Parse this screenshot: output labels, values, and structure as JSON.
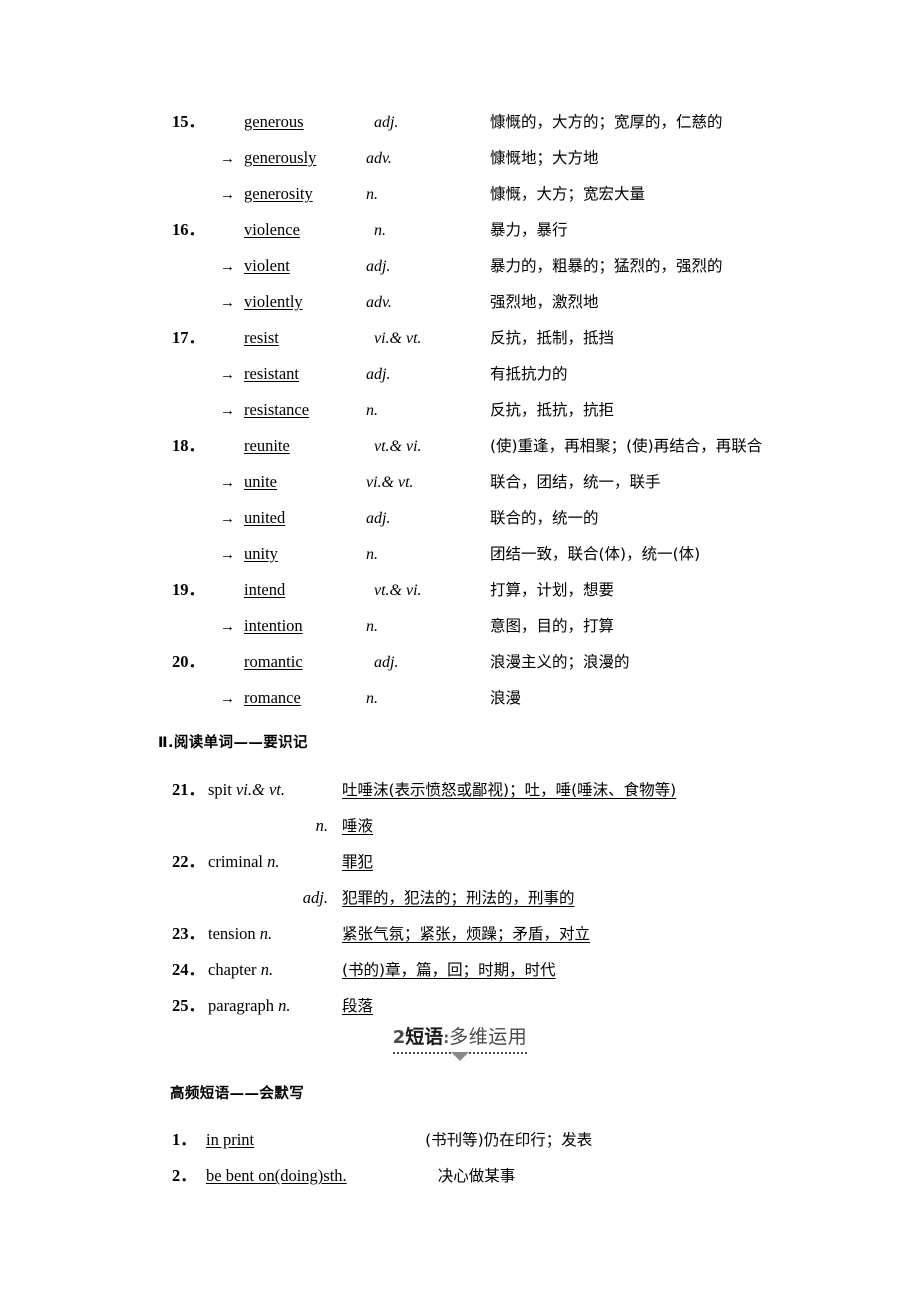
{
  "section_one": {
    "entries": [
      {
        "num": "15．",
        "arrow": "",
        "word": "generous",
        "pos": "adj.",
        "def": "慷慨的，大方的；宽厚的，仁慈的"
      },
      {
        "num": "",
        "arrow": "→",
        "word": "generously",
        "pos": "adv.",
        "def": "慷慨地；大方地"
      },
      {
        "num": "",
        "arrow": "→",
        "word": "generosity",
        "pos": "n.",
        "def": "慷慨，大方；宽宏大量"
      },
      {
        "num": "16．",
        "arrow": "",
        "word": "violence",
        "pos": "n.",
        "def": "暴力，暴行"
      },
      {
        "num": "",
        "arrow": "→",
        "word": "violent",
        "pos": "adj.",
        "def": "暴力的，粗暴的；猛烈的，强烈的"
      },
      {
        "num": "",
        "arrow": "→",
        "word": "violently",
        "pos": "adv.",
        "def": "强烈地，激烈地"
      },
      {
        "num": "17．",
        "arrow": "",
        "word": "resist",
        "pos": "vi.& vt.",
        "def": "反抗，抵制，抵挡"
      },
      {
        "num": "",
        "arrow": "→",
        "word": "resistant",
        "pos": "adj.",
        "def": "有抵抗力的"
      },
      {
        "num": "",
        "arrow": "→",
        "word": "resistance",
        "pos": "n.",
        "def": "反抗，抵抗，抗拒"
      },
      {
        "num": "18．",
        "arrow": "",
        "word": "reunite",
        "pos": "vt.& vi.",
        "def": "(使)重逢，再相聚；(使)再结合，再联合"
      },
      {
        "num": "",
        "arrow": "→",
        "word": "unite",
        "pos": "vi.& vt.",
        "def": "联合，团结，统一，联手"
      },
      {
        "num": "",
        "arrow": "→",
        "word": "united",
        "pos": "adj.",
        "def": "联合的，统一的"
      },
      {
        "num": "",
        "arrow": "→",
        "word": "unity",
        "pos": "n.",
        "def": "团结一致，联合(体)，统一(体)"
      },
      {
        "num": "19．",
        "arrow": "",
        "word": "intend",
        "pos": "vt.& vi.",
        "def": "打算，计划，想要"
      },
      {
        "num": "",
        "arrow": "→",
        "word": "intention",
        "pos": "n.",
        "def": "意图，目的，打算"
      },
      {
        "num": "20．",
        "arrow": "",
        "word": "romantic",
        "pos": "adj.",
        "def": "浪漫主义的；浪漫的"
      },
      {
        "num": "",
        "arrow": "→",
        "word": "romance",
        "pos": "n.",
        "def": "浪漫"
      }
    ]
  },
  "heading_reading": "Ⅱ.阅读单词——要识记",
  "section_two": {
    "entries": [
      {
        "num": "21．",
        "word": "spit ",
        "pos": "vi.& vt.",
        "pos_only": false,
        "def": "吐唾沫(表示愤怒或鄙视)；吐，唾(唾沫、食物等)"
      },
      {
        "num": "",
        "word": "",
        "pos": "n.",
        "pos_only": true,
        "def": "唾液"
      },
      {
        "num": "22．",
        "word": "criminal ",
        "pos": "n.",
        "pos_only": false,
        "def": "罪犯"
      },
      {
        "num": "",
        "word": "",
        "pos": "adj.",
        "pos_only": true,
        "def": "犯罪的，犯法的；刑法的，刑事的"
      },
      {
        "num": "23．",
        "word": "tension ",
        "pos": "n.",
        "pos_only": false,
        "def": "紧张气氛；紧张，烦躁；矛盾，对立"
      },
      {
        "num": "24．",
        "word": "chapter ",
        "pos": "n.",
        "pos_only": false,
        "def": "(书的)章，篇，回；时期，时代"
      },
      {
        "num": "25．",
        "word": "paragraph ",
        "pos": "n.",
        "pos_only": false,
        "def": "段落"
      }
    ]
  },
  "banner": {
    "number": "2",
    "bold_text": "短语",
    "colon": ":",
    "light_text": "多维运用"
  },
  "heading_phrase": "高频短语——会默写",
  "phrases": {
    "entries": [
      {
        "num": "1．",
        "term": "in print",
        "def": "(书刊等)仍在印行；发表",
        "pad": "pad-1"
      },
      {
        "num": "2．",
        "term": "be bent on(doing)sth.",
        "def": "决心做某事",
        "pad": "pad-2"
      }
    ]
  },
  "colors": {
    "text": "#000000",
    "banner_light": "#4a4a4a",
    "banner_triangle": "#8a8a8a"
  }
}
